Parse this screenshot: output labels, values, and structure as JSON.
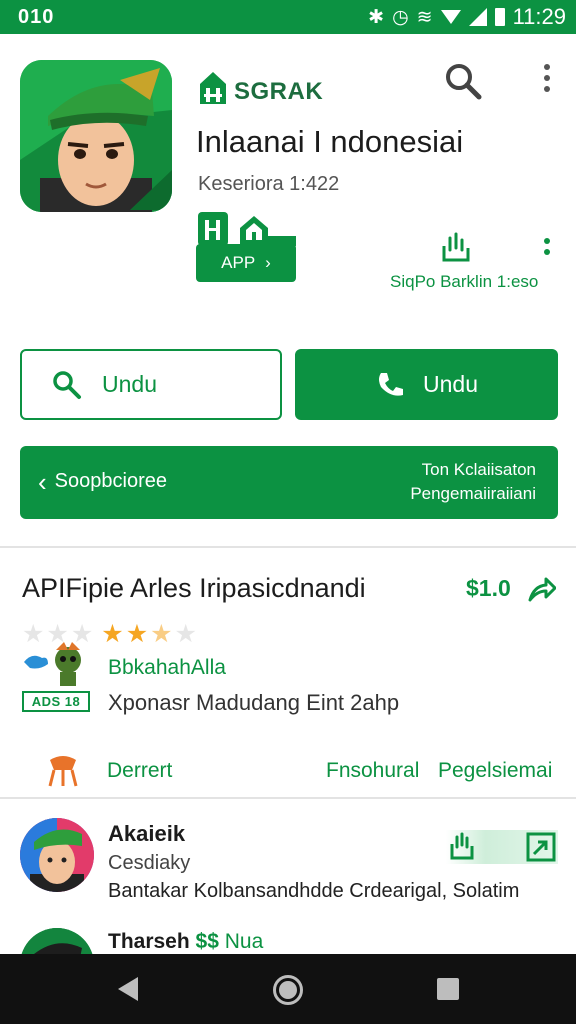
{
  "status_bar": {
    "left_text": "010",
    "time": "11:29",
    "icons": [
      "bluetooth-icon",
      "alarm-icon",
      "wifi-icon",
      "cell-signal-icon",
      "battery-icon"
    ]
  },
  "header": {
    "brand": "SGRAK",
    "title": "Inlaanai I ndonesiai",
    "version": "Keseriora 1:422",
    "badge_label": "APP",
    "badge_arrow": "›",
    "sub_stat": "SiqPo Barklin 1:eso"
  },
  "actions": {
    "outline_button": "Undu",
    "filled_button": "Undu"
  },
  "banner": {
    "left_label": "Soopbcioree",
    "right_line1": "Ton Kclaiisaton",
    "right_line2": "Pengemaiiraiiani"
  },
  "section": {
    "title": "APIFipie Arles Iripasicdnandi",
    "price": "$1.0",
    "rating": {
      "value": 2.5,
      "out_of": 5
    },
    "developer_name": "BbkahahAlla",
    "ads_label": "ADS 18",
    "description": "Xponasr Madudang Eint 2ahp",
    "category_left": "Derrert",
    "category_mid": "Fnsohural",
    "category_right": "Pegelsiemai"
  },
  "review": {
    "name": "Akaieik",
    "date": "Cesdiaky",
    "text": "Bantakar Kolbansandhdde Crdearigal, Solatim"
  },
  "review2": {
    "name": "Tharseh",
    "price": "$$",
    "suffix": "Nua"
  },
  "colors": {
    "brand_green": "#0c9242",
    "star": "#f5a623",
    "navbar": "#111111"
  }
}
